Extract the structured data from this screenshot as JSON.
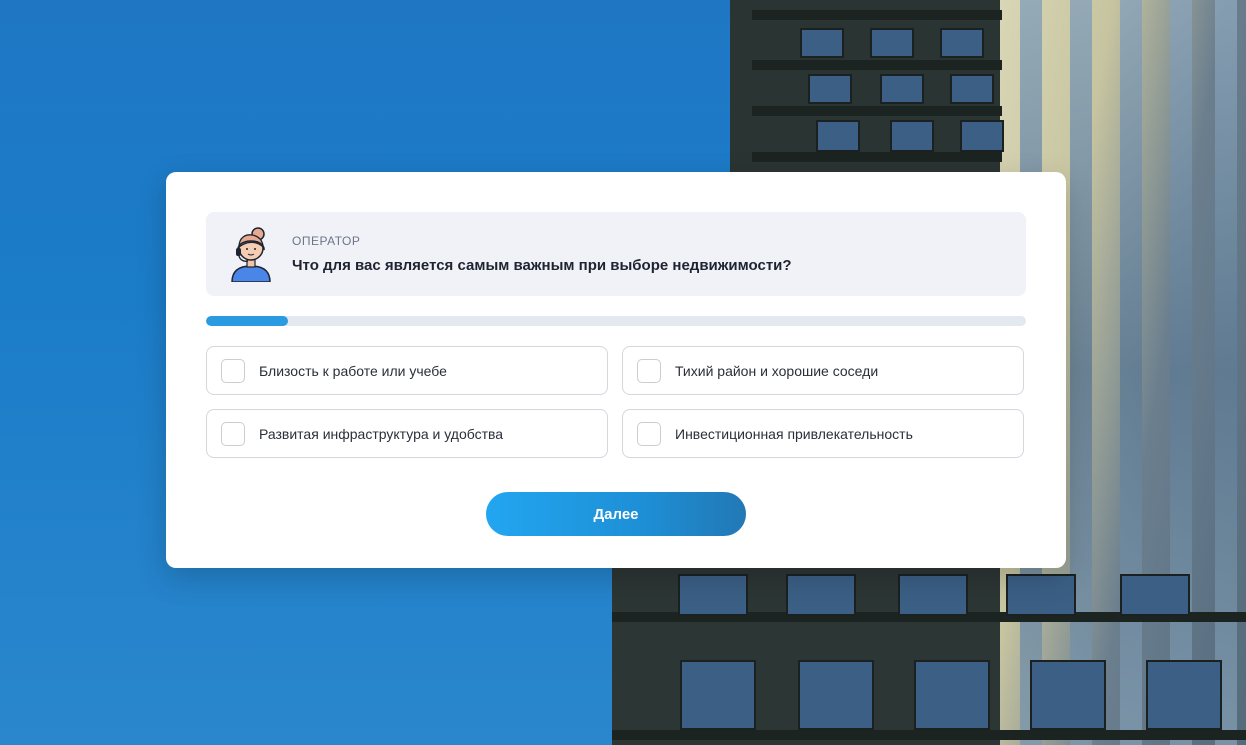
{
  "operator": {
    "label": "ОПЕРАТОР",
    "question": "Что для вас является самым важным при выборе недвижимости?",
    "avatar_icon": "operator-avatar-icon"
  },
  "progress": {
    "fraction": 0.1
  },
  "options": [
    {
      "label": "Близость к работе или учебе",
      "checked": false
    },
    {
      "label": "Тихий район и хорошие соседи",
      "checked": false
    },
    {
      "label": "Развитая инфраструктура и удобства",
      "checked": false
    },
    {
      "label": "Инвестиционная привлекательность",
      "checked": false
    }
  ],
  "next_button": {
    "label": "Далее"
  },
  "colors": {
    "accent": "#2a9be0",
    "background_sky": "#1f7cc6"
  }
}
